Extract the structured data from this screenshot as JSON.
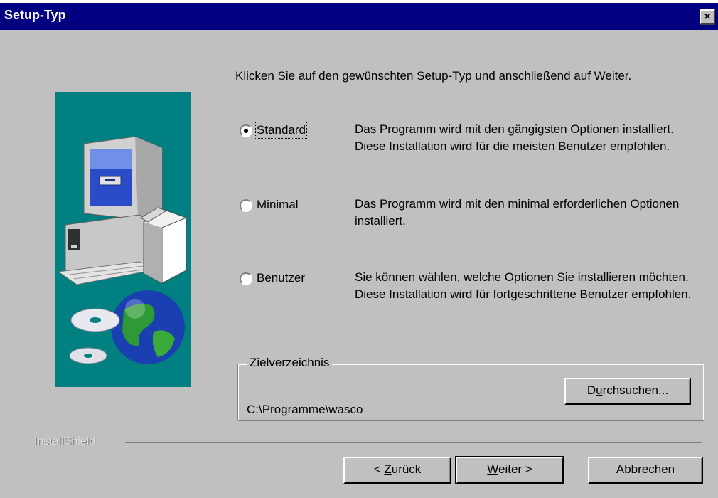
{
  "window": {
    "title": "Setup-Typ",
    "close_glyph": "×"
  },
  "intro_text": "Klicken Sie auf den gewünschten Setup-Typ und anschließend auf Weiter.",
  "options": [
    {
      "label": "Standard",
      "selected": true,
      "description": "Das Programm wird mit den gängigsten Optionen installiert. Diese Installation wird für die meisten Benutzer empfohlen."
    },
    {
      "label": "Minimal",
      "selected": false,
      "description": "Das Programm wird mit den minimal erforderlichen Optionen installiert."
    },
    {
      "label": "Benutzer",
      "selected": false,
      "description": "Sie können wählen, welche Optionen Sie installieren möchten. Diese Installation wird für fortgeschrittene Benutzer empfohlen."
    }
  ],
  "target": {
    "group_label": "Zielverzeichnis",
    "path": "C:\\Programme\\wasco",
    "browse": {
      "pre": "D",
      "accel": "u",
      "post": "rchsuchen..."
    }
  },
  "brand": "InstallShield",
  "buttons": {
    "back": {
      "pre": "< ",
      "accel": "Z",
      "post": "urück"
    },
    "next": {
      "accel": "W",
      "post": "eiter >"
    },
    "cancel": "Abbrechen"
  },
  "colors": {
    "title_bar": "#000080",
    "dialog_bg": "#c0c0c0",
    "illustration_bg": "#008080"
  }
}
